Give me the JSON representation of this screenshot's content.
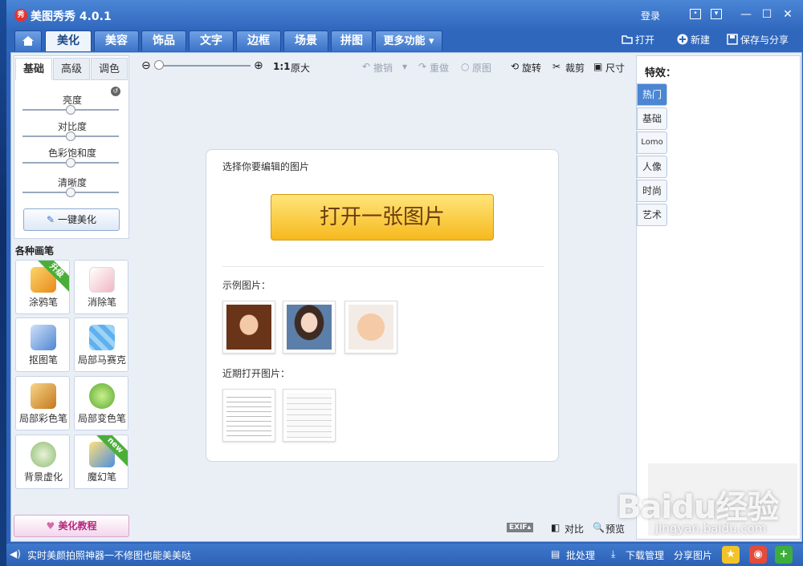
{
  "app": {
    "title": "美图秀秀 4.0.1",
    "logo_text": "秀"
  },
  "titlebar": {
    "login": "登录",
    "minimize": "—",
    "maximize": "☐",
    "close": "✕"
  },
  "nav": {
    "tabs": [
      "美化",
      "美容",
      "饰品",
      "文字",
      "边框",
      "场景",
      "拼图",
      "更多功能 ▾"
    ],
    "active": "美化",
    "actions": {
      "open": "打开",
      "new": "新建",
      "save": "保存与分享"
    }
  },
  "adjust": {
    "tabs": [
      "基础",
      "高级",
      "调色"
    ],
    "active_tab": "基础",
    "sliders": [
      {
        "label": "亮度",
        "value": 0.5
      },
      {
        "label": "对比度",
        "value": 0.5
      },
      {
        "label": "色彩饱和度",
        "value": 0.5
      },
      {
        "label": "清晰度",
        "value": 0.5
      }
    ],
    "one_click": "一键美化"
  },
  "brushes": {
    "heading": "各种画笔",
    "items": [
      {
        "label": "涂鸦笔",
        "badge": "升级",
        "color": "#f0a32a"
      },
      {
        "label": "消除笔",
        "badge": "",
        "color": "#f4b7c4"
      },
      {
        "label": "抠图笔",
        "badge": "",
        "color": "#5a8fd6"
      },
      {
        "label": "局部马赛克",
        "badge": "",
        "color": "#7fc3f0"
      },
      {
        "label": "局部彩色笔",
        "badge": "",
        "color": "#e3a12c"
      },
      {
        "label": "局部变色笔",
        "badge": "",
        "color": "#8fcf4f"
      },
      {
        "label": "背景虚化",
        "badge": "",
        "color": "#9bc686"
      },
      {
        "label": "魔幻笔",
        "badge": "new",
        "color": "#6aa6e8"
      }
    ]
  },
  "tutorial": "美化教程",
  "toolbar": {
    "original_size_ratio": "1:1",
    "original_size": "原大",
    "undo": "撤销",
    "redo": "重做",
    "original": "原图",
    "rotate": "旋转",
    "crop": "裁剪",
    "size": "尺寸"
  },
  "card": {
    "select_prompt": "选择你要编辑的图片",
    "open_button": "打开一张图片",
    "samples_label": "示例图片：",
    "recent_label": "近期打开图片："
  },
  "bottom_tools": {
    "exif": "EXIF▴",
    "compare": "对比",
    "preview": "预览"
  },
  "effects": {
    "title": "特效：",
    "tabs": [
      "热门",
      "基础",
      "Lomo",
      "人像",
      "时尚",
      "艺术"
    ],
    "active": "热门"
  },
  "status": {
    "tip": "实时美颜拍照神器一不修图也能美美哒",
    "batch": "批处理",
    "download": "下载管理",
    "share": "分享图片"
  },
  "watermark": {
    "brand": "Baidu经验",
    "url": "jingyan.baidu.com"
  }
}
